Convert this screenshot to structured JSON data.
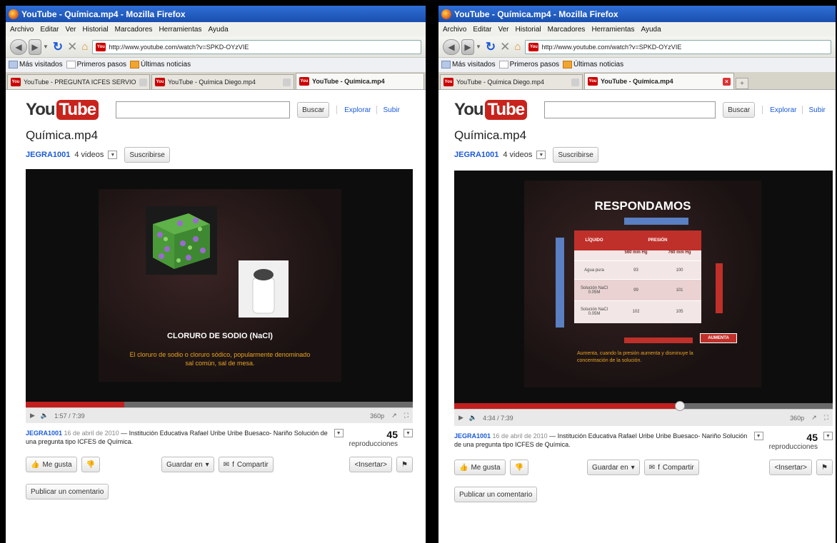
{
  "browser": {
    "title": "YouTube - Química.mp4 - Mozilla Firefox",
    "menu": [
      "Archivo",
      "Editar",
      "Ver",
      "Historial",
      "Marcadores",
      "Herramientas",
      "Ayuda"
    ],
    "url": "http://www.youtube.com/watch?v=SPKD-OYzVIE",
    "bookmarks": [
      "Más visitados",
      "Primeros pasos",
      "Últimas noticias"
    ],
    "icons": {
      "back": "back-arrow-icon",
      "forward": "forward-arrow-icon",
      "reload": "reload-icon",
      "stop": "stop-icon",
      "home": "home-icon"
    }
  },
  "left": {
    "tabs": [
      "YouTube - PREGUNTA ICFES SERVIO",
      "YouTube - Química Diego.mp4",
      "YouTube - Química.mp4"
    ],
    "time": "1:57 / 7:39",
    "progress_fraction": 0.255,
    "slide": {
      "heading": "CLORURO DE SODIO (NaCl)",
      "text": "El cloruro de sodio o cloruro sódico, popularmente denominado sal común, sal de mesa."
    }
  },
  "right": {
    "tabs": [
      "YouTube - Química Diego.mp4",
      "YouTube - Química.mp4"
    ],
    "time": "4:34 / 7:39",
    "progress_fraction": 0.597,
    "slide": {
      "heading": "RESPONDAMOS",
      "table_header": [
        "LÍQUIDO",
        "PRESIÓN"
      ],
      "sub_header": [
        "560 mm Hg",
        "760 mm Hg"
      ],
      "rows": [
        [
          "Agua pura",
          "93",
          "100"
        ],
        [
          "Solución NaCl 0.05M",
          "99",
          "101"
        ],
        [
          "Solución NaCl 0.05M",
          "102",
          "105"
        ]
      ],
      "badge": "AUMENTA",
      "note": "Aumenta, cuando la presión aumenta y disminuye la concentración de la solución."
    }
  },
  "youtube": {
    "logo_you": "You",
    "logo_tube": "Tube",
    "search_button": "Buscar",
    "explore": "Explorar",
    "upload": "Subir",
    "video_title": "Química.mp4",
    "channel": "JEGRA1001",
    "videos": "4 videos",
    "subscribe": "Suscribirse",
    "quality": "360p",
    "desc_channel": "JEGRA1001",
    "desc_date": "16 de abril de 2010",
    "desc_text": "— Institución Educativa Rafael Uribe Uribe Buesaco- Nariño Solución de una pregunta tipo ICFES de Química.",
    "views": "45",
    "views_label": "reproducciones",
    "like": "Me gusta",
    "save": "Guardar en",
    "share": "Compartir",
    "embed": "<Insertar>",
    "post_comment": "Publicar un comentario"
  }
}
